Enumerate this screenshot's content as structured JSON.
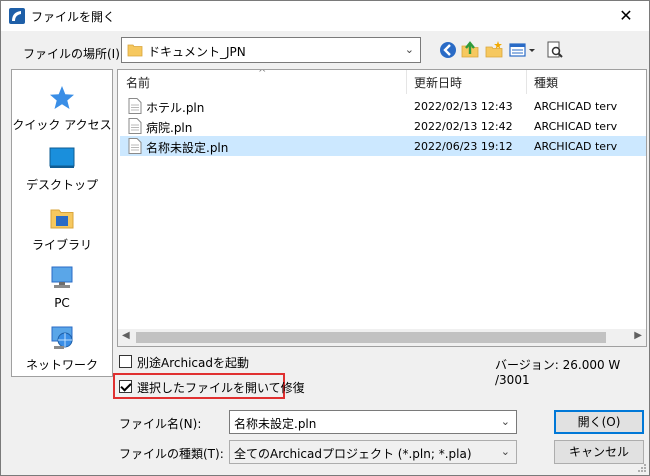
{
  "window": {
    "title": "ファイルを開く",
    "close_glyph": "✕"
  },
  "lookin": {
    "label": "ファイルの場所(I):",
    "value": "ドキュメント_JPN"
  },
  "toolbar": {
    "icons": [
      "back-icon",
      "up-folder-icon",
      "new-folder-icon",
      "view-menu-icon",
      "preview-icon"
    ]
  },
  "places": [
    {
      "label": "クイック アクセス",
      "icon": "quick-access-star-icon"
    },
    {
      "label": "デスクトップ",
      "icon": "desktop-icon"
    },
    {
      "label": "ライブラリ",
      "icon": "library-icon"
    },
    {
      "label": "PC",
      "icon": "pc-icon"
    },
    {
      "label": "ネットワーク",
      "icon": "network-icon"
    }
  ],
  "filelist": {
    "columns": {
      "name": "名前",
      "date": "更新日時",
      "kind": "種類"
    },
    "rows": [
      {
        "name": "ホテル.pln",
        "date": "2022/02/13 12:43",
        "kind": "ARCHICAD terv",
        "selected": false
      },
      {
        "name": "病院.pln",
        "date": "2022/02/13 12:42",
        "kind": "ARCHICAD terv",
        "selected": false
      },
      {
        "name": "名称未設定.pln",
        "date": "2022/06/23 19:12",
        "kind": "ARCHICAD terv",
        "selected": true
      }
    ]
  },
  "options": {
    "launch_separate_label": "別途Archicadを起動",
    "launch_separate_checked": false,
    "open_repair_label": "選択したファイルを開いて修復",
    "open_repair_checked": true,
    "version_text": "バージョン: 26.000 W /3001"
  },
  "filename": {
    "label": "ファイル名(N):",
    "value": "名称未設定.pln"
  },
  "filetype": {
    "label": "ファイルの種類(T):",
    "value": "全てのArchicadプロジェクト (*.pln; *.pla)"
  },
  "buttons": {
    "open": "開く(O)",
    "cancel": "キャンセル"
  },
  "colors": {
    "selection": "#cce8ff",
    "highlight_box": "#e03030",
    "default_button_border": "#0078d7"
  }
}
